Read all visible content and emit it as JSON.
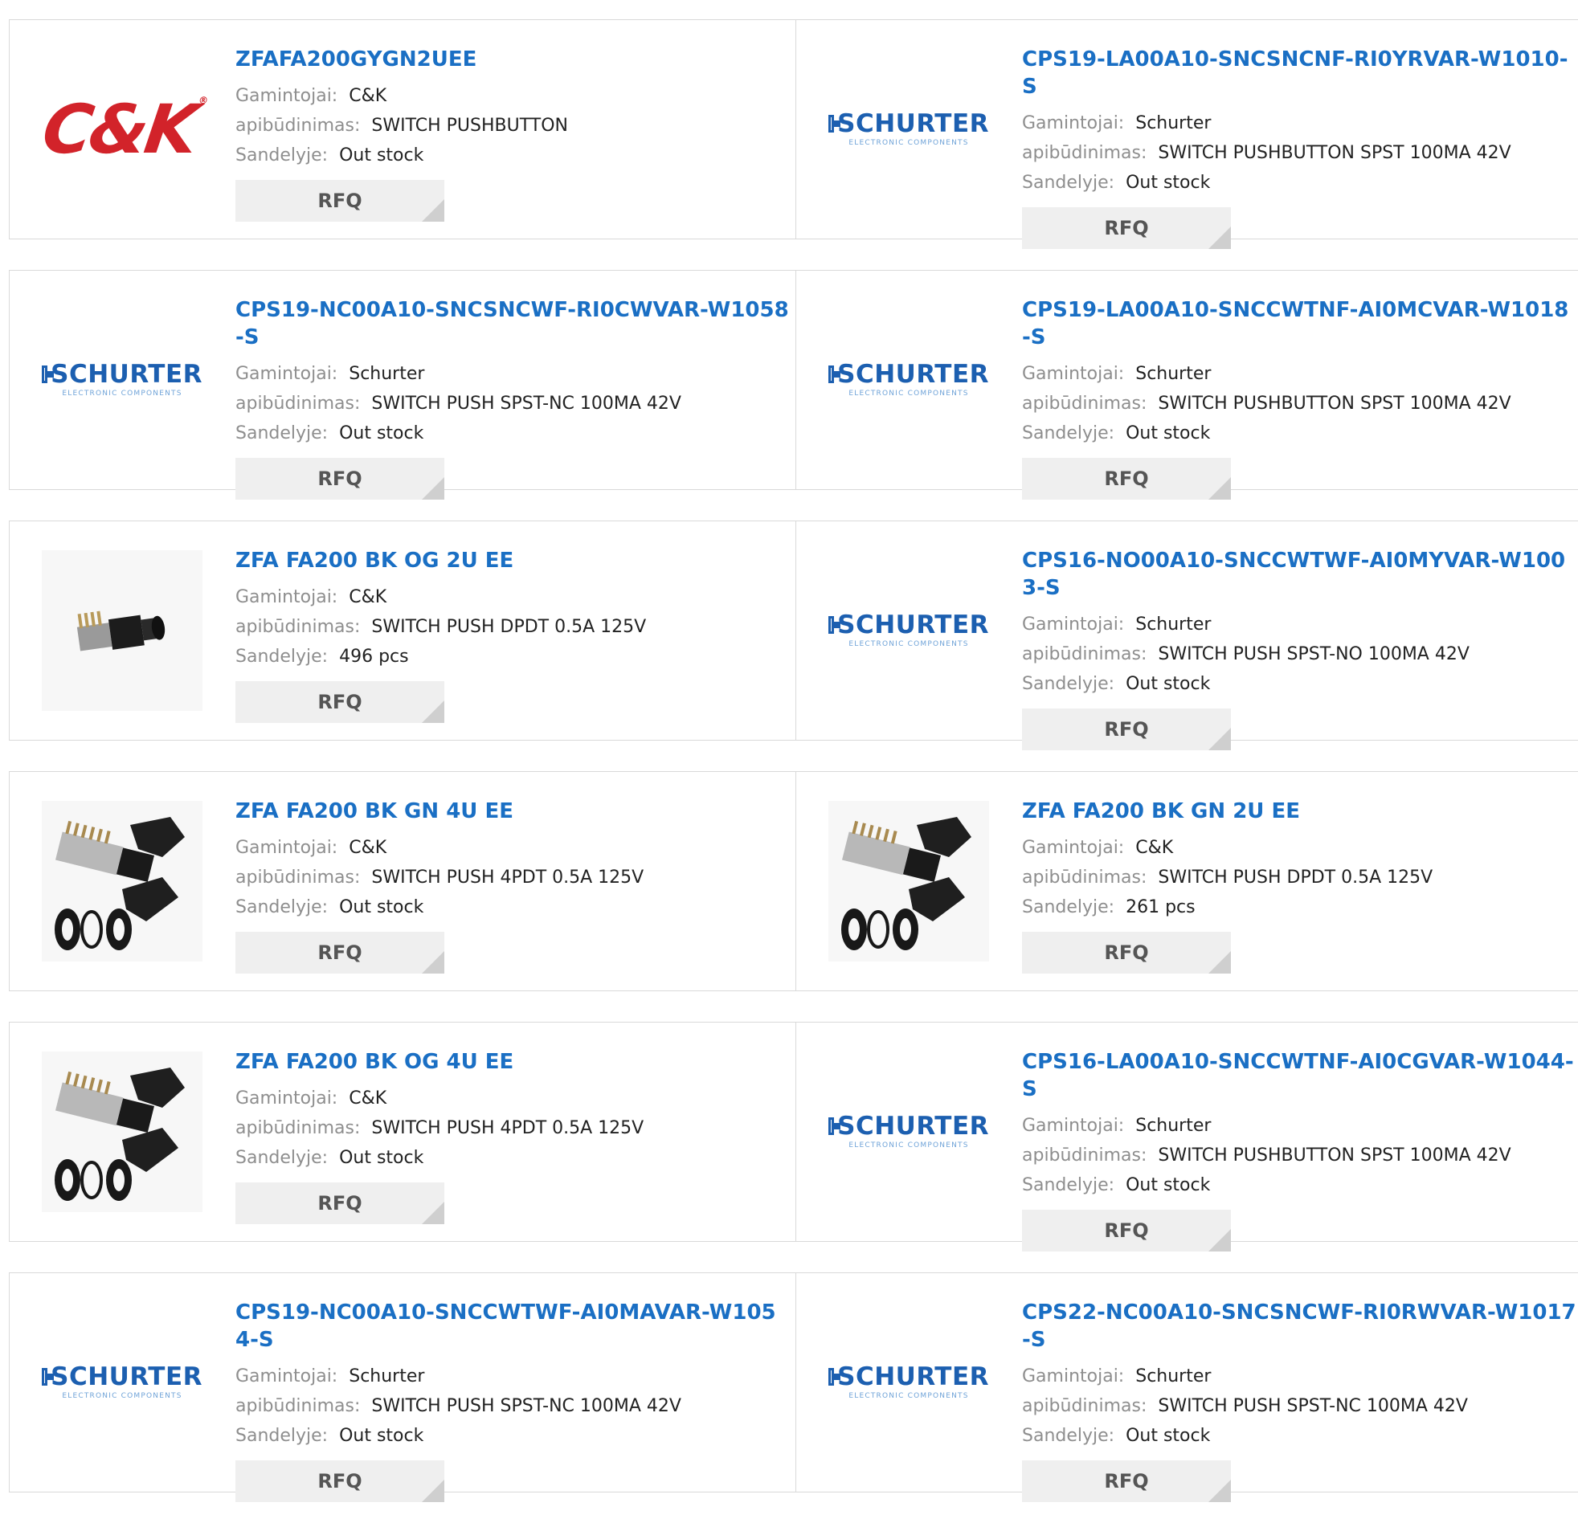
{
  "labels": {
    "manufacturer": "Gamintojai:",
    "description": "apibūdinimas:",
    "stock": "Sandelyje:",
    "rfq": "RFQ"
  },
  "logos": {
    "ck": {
      "main": "C&K",
      "registered": "®"
    },
    "schurter": {
      "name": "SCHURTER",
      "tagline": "ELECTRONIC COMPONENTS"
    }
  },
  "colors": {
    "title": "#1a6fc4",
    "ck_red": "#d2232a",
    "schurter_blue": "#1c5fb0"
  },
  "products": [
    {
      "part": "ZFAFA200GYGN2UEE",
      "manufacturer": "C&K",
      "description": "SWITCH PUSHBUTTON",
      "stock": "Out stock",
      "image": "ck-logo"
    },
    {
      "part": "CPS19-LA00A10-SNCSNCNF-RI0YRVAR-W1010-S",
      "manufacturer": "Schurter",
      "description": "SWITCH PUSHBUTTON SPST 100MA 42V",
      "stock": "Out stock",
      "image": "schurter-logo"
    },
    {
      "part": "CPS19-NC00A10-SNCSNCWF-RI0CWVAR-W1058-S",
      "manufacturer": "Schurter",
      "description": "SWITCH PUSH SPST-NC 100MA 42V",
      "stock": "Out stock",
      "image": "schurter-logo"
    },
    {
      "part": "CPS19-LA00A10-SNCCWTNF-AI0MCVAR-W1018-S",
      "manufacturer": "Schurter",
      "description": "SWITCH PUSHBUTTON SPST 100MA 42V",
      "stock": "Out stock",
      "image": "schurter-logo"
    },
    {
      "part": "ZFA FA200 BK OG 2U EE",
      "manufacturer": "C&K",
      "description": "SWITCH PUSH DPDT 0.5A 125V",
      "stock": "496 pcs",
      "image": "switch-photo-single"
    },
    {
      "part": "CPS16-NO00A10-SNCCWTWF-AI0MYVAR-W1003-S",
      "manufacturer": "Schurter",
      "description": "SWITCH PUSH SPST-NO 100MA 42V",
      "stock": "Out stock",
      "image": "schurter-logo"
    },
    {
      "part": "ZFA FA200 BK GN 4U EE",
      "manufacturer": "C&K",
      "description": "SWITCH PUSH 4PDT 0.5A 125V",
      "stock": "Out stock",
      "image": "switch-photo-kit"
    },
    {
      "part": "ZFA FA200 BK GN 2U EE",
      "manufacturer": "C&K",
      "description": "SWITCH PUSH DPDT 0.5A 125V",
      "stock": "261 pcs",
      "image": "switch-photo-kit"
    },
    {
      "part": "ZFA FA200 BK OG 4U EE",
      "manufacturer": "C&K",
      "description": "SWITCH PUSH 4PDT 0.5A 125V",
      "stock": "Out stock",
      "image": "switch-photo-kit"
    },
    {
      "part": "CPS16-LA00A10-SNCCWTNF-AI0CGVAR-W1044-S",
      "manufacturer": "Schurter",
      "description": "SWITCH PUSHBUTTON SPST 100MA 42V",
      "stock": "Out stock",
      "image": "schurter-logo"
    },
    {
      "part": "CPS19-NC00A10-SNCCWTWF-AI0MAVAR-W1054-S",
      "manufacturer": "Schurter",
      "description": "SWITCH PUSH SPST-NC 100MA 42V",
      "stock": "Out stock",
      "image": "schurter-logo"
    },
    {
      "part": "CPS22-NC00A10-SNCSNCWF-RI0RWVAR-W1017-S",
      "manufacturer": "Schurter",
      "description": "SWITCH PUSH SPST-NC 100MA 42V",
      "stock": "Out stock",
      "image": "schurter-logo"
    }
  ]
}
